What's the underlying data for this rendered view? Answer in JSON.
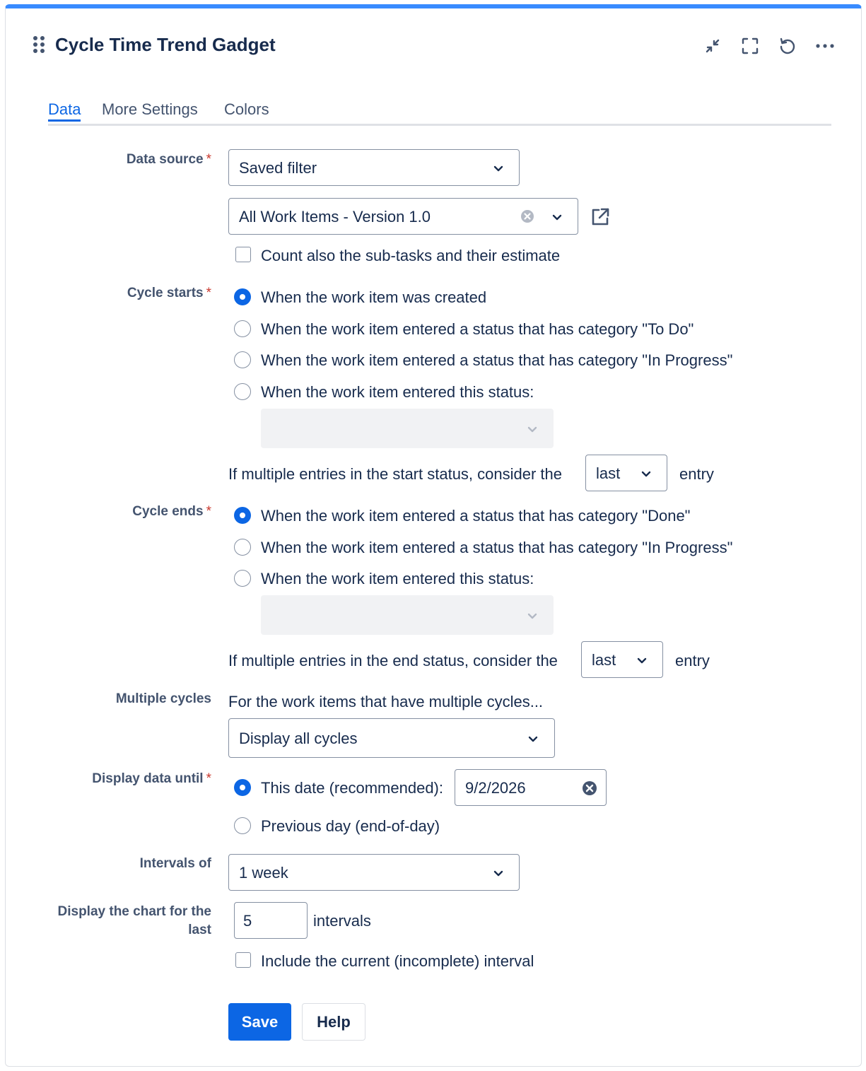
{
  "gadget": {
    "title": "Cycle Time Trend Gadget",
    "accent_color": "#388bff",
    "header_icons": [
      "minimize-icon",
      "fullscreen-icon",
      "refresh-icon",
      "more-options-icon"
    ]
  },
  "tabs": [
    {
      "label": "Data",
      "active": true
    },
    {
      "label": "More Settings",
      "active": false
    },
    {
      "label": "Colors",
      "active": false
    }
  ],
  "form": {
    "data_source": {
      "label": "Data source",
      "required_mark": "*",
      "type_value": "Saved filter",
      "filter_value": "All Work Items - Version 1.0",
      "subtasks_label": "Count also the sub-tasks and their estimate",
      "subtasks_checked": false
    },
    "cycle_starts": {
      "label": "Cycle starts",
      "required_mark": "*",
      "options": [
        "When the work item was created",
        "When the work item entered a status that has category \"To Do\"",
        "When the work item entered a status that has category \"In Progress\"",
        "When the work item entered this status:"
      ],
      "selected_index": 0,
      "status_value": "",
      "multiple_text": "If multiple entries in the start status, consider the",
      "multiple_value": "last",
      "multiple_suffix": "entry"
    },
    "cycle_ends": {
      "label": "Cycle ends",
      "required_mark": "*",
      "options": [
        "When the work item entered a status that has category \"Done\"",
        "When the work item entered a status that has category \"In Progress\"",
        "When the work item entered this status:"
      ],
      "selected_index": 0,
      "status_value": "",
      "multiple_text": "If multiple entries in the end status, consider the",
      "multiple_value": "last",
      "multiple_suffix": "entry"
    },
    "multiple_cycles": {
      "label": "Multiple cycles",
      "description": "For the work items that have multiple cycles...",
      "value": "Display all cycles"
    },
    "display_until": {
      "label": "Display data until",
      "required_mark": "*",
      "this_date_label": "This date (recommended):",
      "date_value": "9/2/2026",
      "previous_day_label": "Previous day (end-of-day)",
      "selected": "this_date"
    },
    "intervals_of": {
      "label": "Intervals of",
      "value": "1 week"
    },
    "display_last": {
      "label_line1": "Display the chart for the",
      "label_line2": "last",
      "value": "5",
      "suffix": "intervals",
      "include_current_label": "Include the current (incomplete) interval",
      "include_current_checked": false
    },
    "buttons": {
      "save": "Save",
      "help": "Help"
    }
  }
}
